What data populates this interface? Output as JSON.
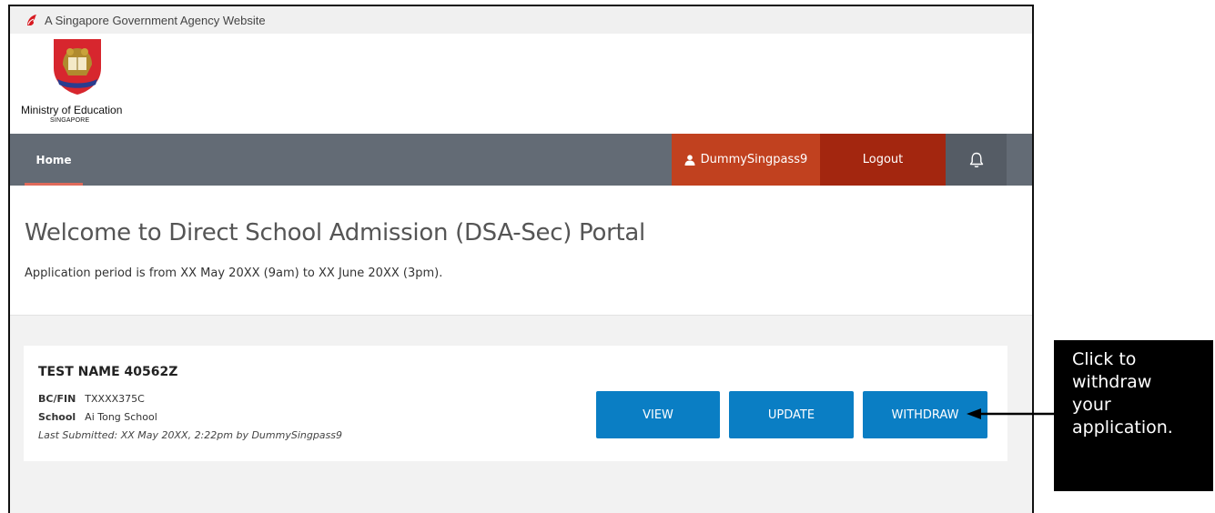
{
  "masthead": {
    "text": "A Singapore Government Agency Website",
    "icon": "lion-head-icon"
  },
  "org": {
    "name": "Ministry of Education",
    "sub": "SINGAPORE",
    "crest": "moe-crest-icon"
  },
  "nav": {
    "home": "Home",
    "user": "DummySingpass9",
    "logout": "Logout",
    "bell_icon": "bell-icon",
    "colors": {
      "bar": "#636b75",
      "user": "#c1411f",
      "logout": "#a3260f",
      "accent": "#e06a5a"
    }
  },
  "welcome": {
    "title": "Welcome to Direct School Admission (DSA-Sec) Portal",
    "subtitle": "Application period is from XX May 20XX (9am) to XX June 20XX (3pm)."
  },
  "application": {
    "name": "TEST NAME 40562Z",
    "bcfin_label": "BC/FIN",
    "bcfin_value": "TXXXX375C",
    "school_label": "School",
    "school_value": "Ai Tong School",
    "last_submitted": "Last Submitted: XX May 20XX, 2:22pm by DummySingpass9",
    "buttons": {
      "view": "VIEW",
      "update": "UPDATE",
      "withdraw": "WITHDRAW"
    },
    "button_color": "#0a7ec4"
  },
  "callout": {
    "lines": [
      "Click to",
      "withdraw",
      "your",
      "application."
    ]
  }
}
